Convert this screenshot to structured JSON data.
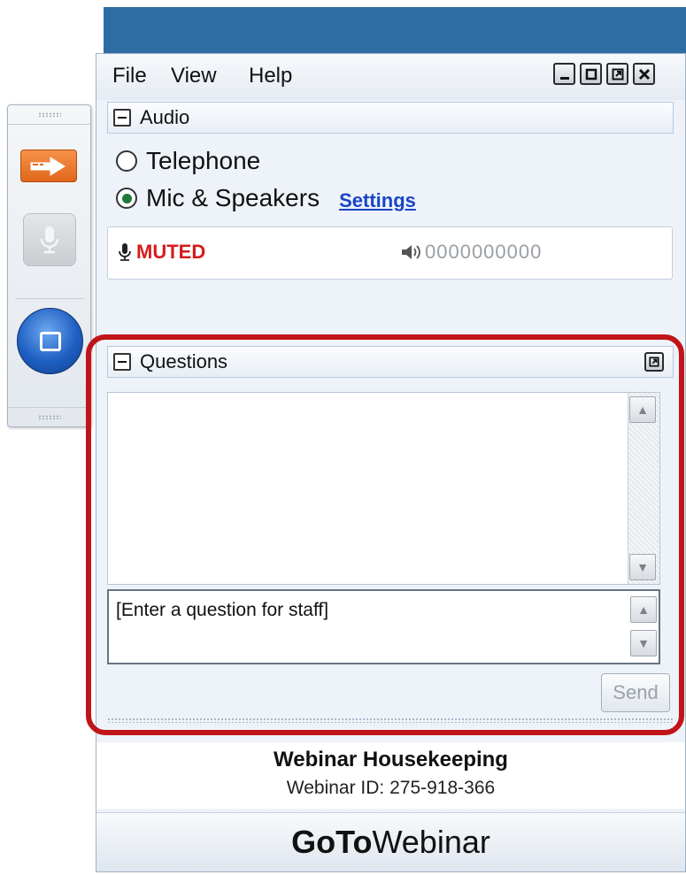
{
  "menu": {
    "file": "File",
    "view": "View",
    "help": "Help"
  },
  "window_controls": [
    "minimize",
    "maximize",
    "pop-out",
    "close"
  ],
  "audio": {
    "title": "Audio",
    "options": [
      {
        "label": "Telephone",
        "selected": false
      },
      {
        "label": "Mic & Speakers",
        "selected": true
      }
    ],
    "settings_link": "Settings",
    "status": "MUTED",
    "level": "0000000000"
  },
  "questions": {
    "title": "Questions",
    "input_placeholder": "[Enter a question for staff]",
    "send_label": "Send"
  },
  "footer": {
    "title": "Webinar Housekeeping",
    "webinar_id": "Webinar ID: 275-918-366"
  },
  "brand": {
    "bold": "GoTo",
    "regular": "Webinar"
  },
  "colors": {
    "highlight_frame": "#c0141a",
    "muted": "#d41c1c",
    "link": "#1a44c8",
    "accent_orange": "#e0661b"
  }
}
